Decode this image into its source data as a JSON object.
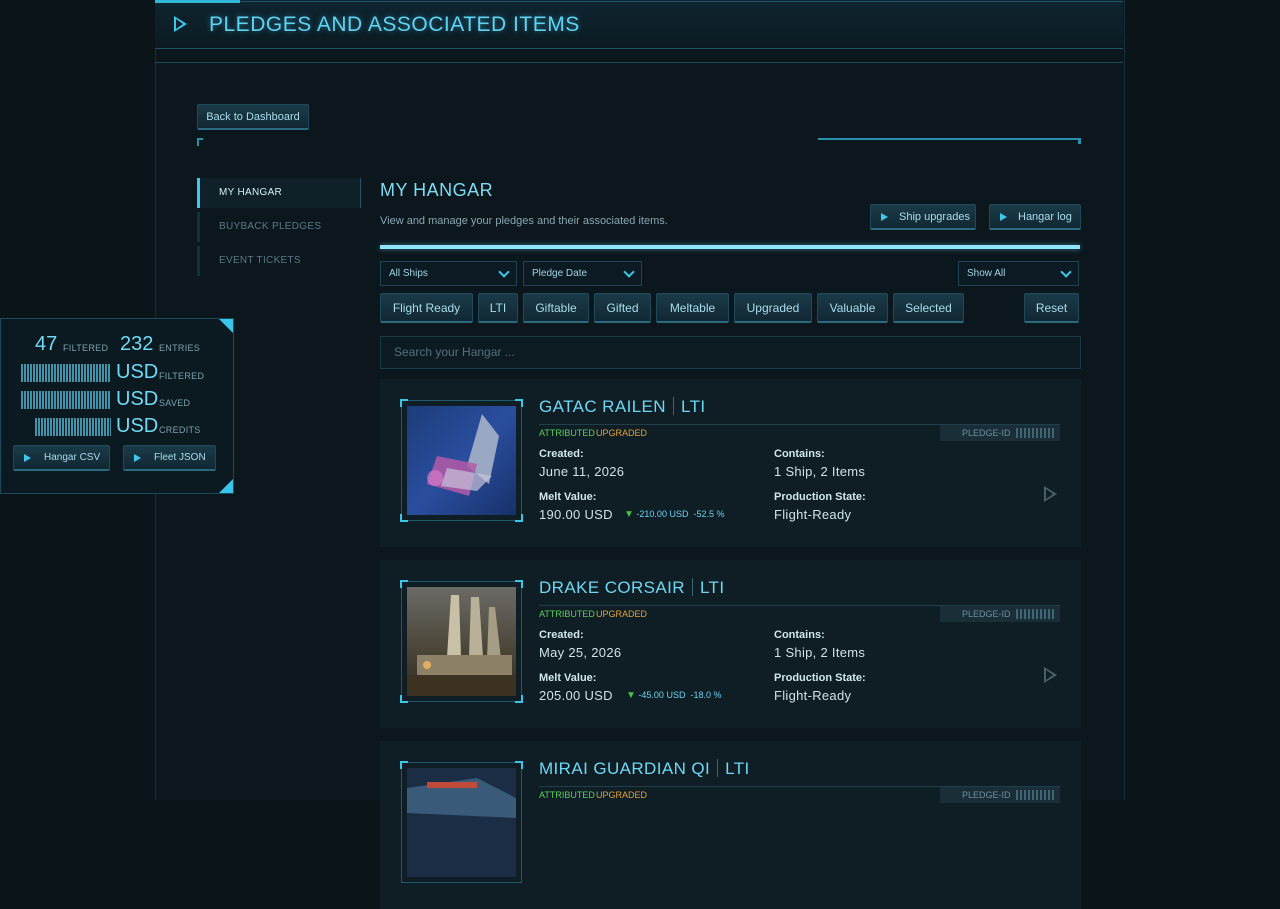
{
  "page": {
    "title": "PLEDGES AND ASSOCIATED ITEMS"
  },
  "nav": {
    "back_label": "Back to Dashboard",
    "items": [
      {
        "label": "MY HANGAR",
        "active": true
      },
      {
        "label": "BUYBACK PLEDGES",
        "active": false
      },
      {
        "label": "EVENT TICKETS",
        "active": false
      }
    ]
  },
  "section": {
    "title": "MY HANGAR",
    "description": "View and manage your pledges and their associated items.",
    "ship_upgrades_label": "Ship upgrades",
    "hangar_log_label": "Hangar log"
  },
  "filters": {
    "ships_select": "All Ships",
    "sort_select": "Pledge Date",
    "show_select": "Show All",
    "chips": [
      "Flight Ready",
      "LTI",
      "Giftable",
      "Gifted",
      "Meltable",
      "Upgraded",
      "Valuable",
      "Selected"
    ],
    "reset_label": "Reset",
    "search_placeholder": "Search your Hangar ..."
  },
  "stats": {
    "filtered_count": "47",
    "filtered_label": "FILTERED",
    "entries_count": "232",
    "entries_label": "ENTRIES",
    "currency": "USD",
    "usd_filtered_label": "FILTERED",
    "usd_saved_label": "SAVED",
    "usd_credits_label": "CREDITS",
    "csv_label": "Hangar CSV",
    "json_label": "Fleet JSON"
  },
  "pledges": [
    {
      "name": "GATAC RAILEN",
      "insurance": "LTI",
      "tag_attributed": "ATTRIBUTED",
      "tag_upgraded": "UPGRADED",
      "pledge_id_label": "PLEDGE-ID",
      "created_label": "Created:",
      "created": "June 11, 2026",
      "contains_label": "Contains:",
      "contains": "1 Ship, 2 Items",
      "melt_label": "Melt Value:",
      "melt": "190.00 USD",
      "delta_arrow": "▼",
      "delta_amount": "-210.00 USD",
      "delta_percent": "-52.5 %",
      "state_label": "Production State:",
      "state": "Flight-Ready"
    },
    {
      "name": "DRAKE CORSAIR",
      "insurance": "LTI",
      "tag_attributed": "ATTRIBUTED",
      "tag_upgraded": "UPGRADED",
      "pledge_id_label": "PLEDGE-ID",
      "created_label": "Created:",
      "created": "May 25, 2026",
      "contains_label": "Contains:",
      "contains": "1 Ship, 2 Items",
      "melt_label": "Melt Value:",
      "melt": "205.00 USD",
      "delta_arrow": "▼",
      "delta_amount": "-45.00 USD",
      "delta_percent": "-18.0 %",
      "state_label": "Production State:",
      "state": "Flight-Ready"
    },
    {
      "name": "MIRAI GUARDIAN QI",
      "insurance": "LTI",
      "tag_attributed": "ATTRIBUTED",
      "tag_upgraded": "UPGRADED",
      "pledge_id_label": "PLEDGE-ID"
    }
  ]
}
